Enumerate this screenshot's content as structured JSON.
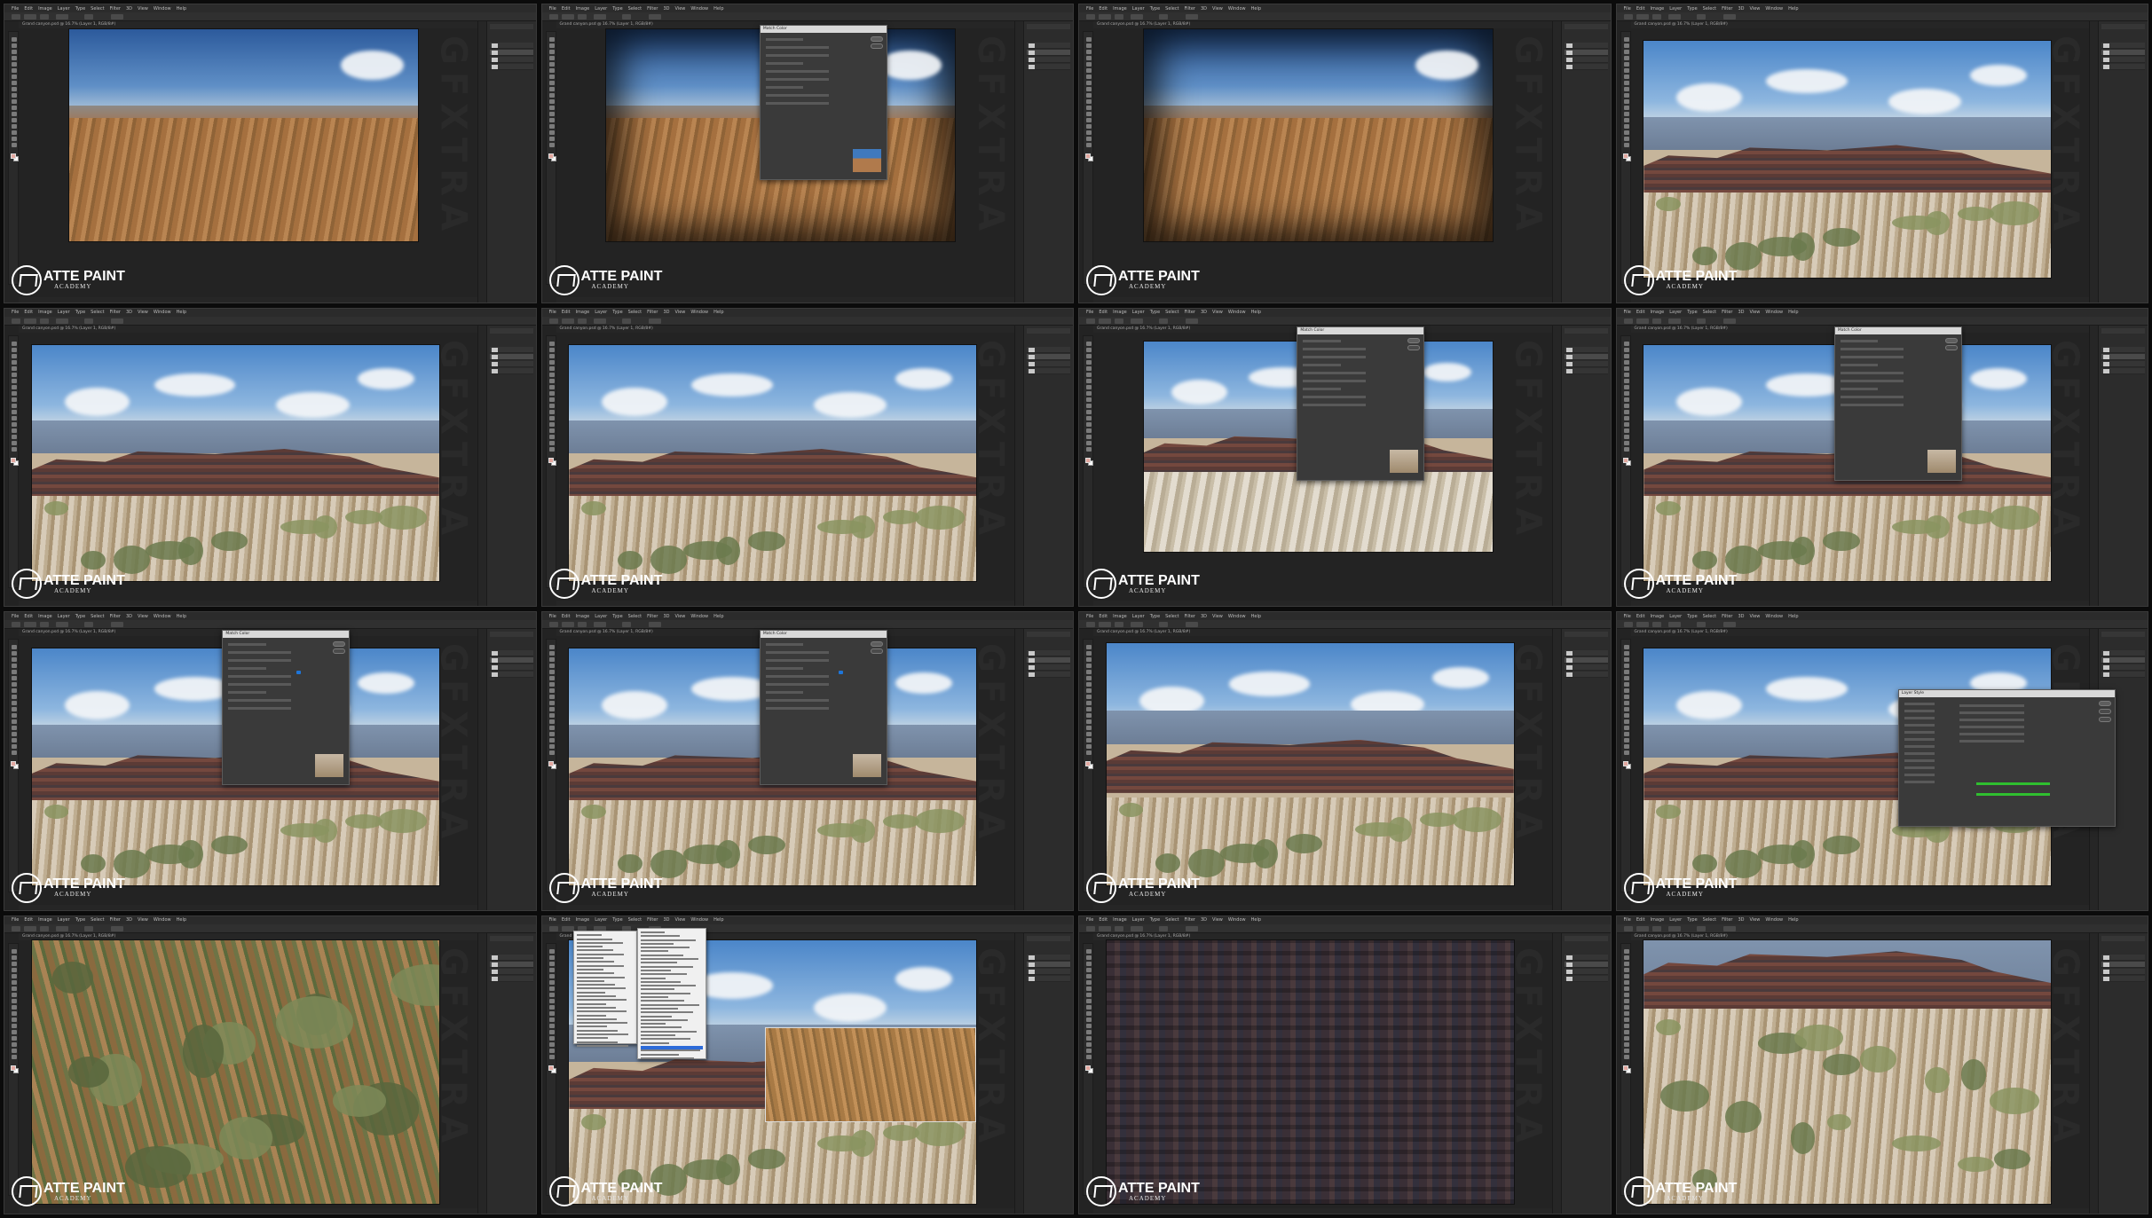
{
  "app": {
    "menus": [
      "File",
      "Edit",
      "Image",
      "Layer",
      "Type",
      "Select",
      "Filter",
      "3D",
      "View",
      "Window",
      "Help"
    ],
    "doc_tab": "Grand canyon.psd @ 16.7% (Layer 1, RGB/8#)"
  },
  "branding": {
    "logo_main": "ATTE PAINT",
    "logo_sub": "ACADEMY",
    "watermark": "GFXTRA"
  },
  "dialogs": {
    "match_color": "Match Color",
    "layer_style": "Layer Style"
  },
  "colors": {
    "foreground_swatch": "#e3a8a0",
    "selection_blue": "#1e75d9",
    "slider_green": "#2fbf2f"
  },
  "frames": [
    {
      "scene": "desert",
      "dialog": "",
      "menu": false
    },
    {
      "scene": "desert-vignette",
      "dialog": "match_color",
      "menu": false
    },
    {
      "scene": "desert-vignette",
      "dialog": "",
      "menu": false
    },
    {
      "scene": "canyon",
      "dialog": "",
      "menu": false
    },
    {
      "scene": "canyon",
      "dialog": "",
      "menu": false
    },
    {
      "scene": "canyon",
      "dialog": "",
      "menu": false
    },
    {
      "scene": "canyon-desert",
      "dialog": "match_color",
      "menu": false
    },
    {
      "scene": "canyon",
      "dialog": "match_color",
      "menu": false
    },
    {
      "scene": "canyon",
      "dialog": "match_color",
      "menu": false
    },
    {
      "scene": "canyon",
      "dialog": "match_color",
      "menu": false
    },
    {
      "scene": "canyon-wide",
      "dialog": "",
      "menu": false
    },
    {
      "scene": "canyon",
      "dialog": "layer_style",
      "menu": false
    },
    {
      "scene": "closeup-brush",
      "dialog": "",
      "menu": false
    },
    {
      "scene": "canyon-patch",
      "dialog": "",
      "menu": true
    },
    {
      "scene": "cliff-dark",
      "dialog": "",
      "menu": false
    },
    {
      "scene": "cliff-brush",
      "dialog": "",
      "menu": false
    }
  ]
}
